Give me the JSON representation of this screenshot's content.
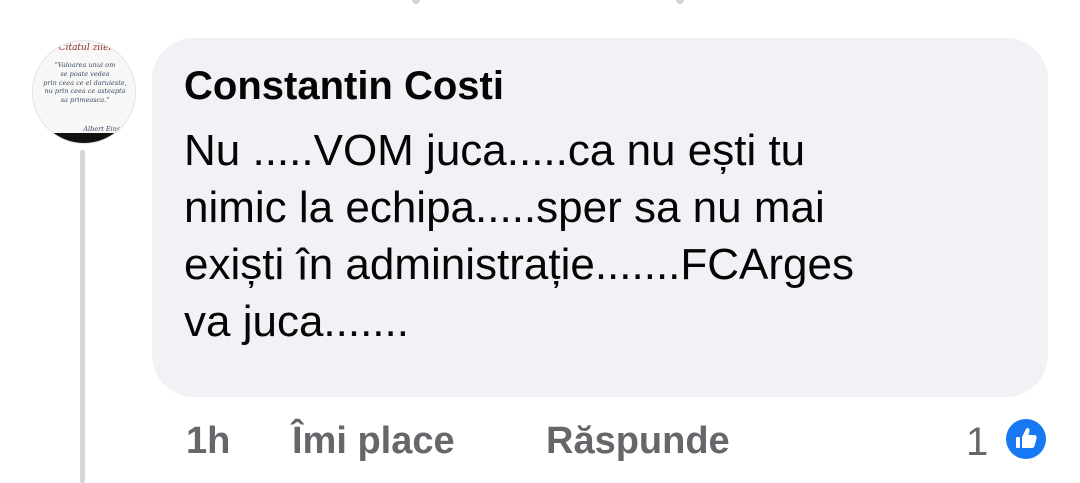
{
  "avatar": {
    "header": "Citatul zilei",
    "quote": "\"Valoarea unui om\nse poate vedea\nprin ceea ce el daruieste,\nnu prin ceea ce asteapta\nsa primeasca.\"",
    "author": "Albert Einstein"
  },
  "comment": {
    "author": "Constantin Costi",
    "text": "Nu .....VOM juca.....ca nu ești tu\nnimic la echipa.....sper sa nu mai\nexiști în administrație.......FCArges\nva juca.......",
    "time": "1h",
    "like_label": "Îmi place",
    "reply_label": "Răspunde",
    "reaction_count": "1",
    "reaction_icon": "like-icon"
  },
  "colors": {
    "bubble_bg": "#f0f2f5",
    "text": "#050505",
    "secondary_text": "#65676b",
    "like_blue": "#1877f2",
    "thread_line": "#d5d7db"
  }
}
